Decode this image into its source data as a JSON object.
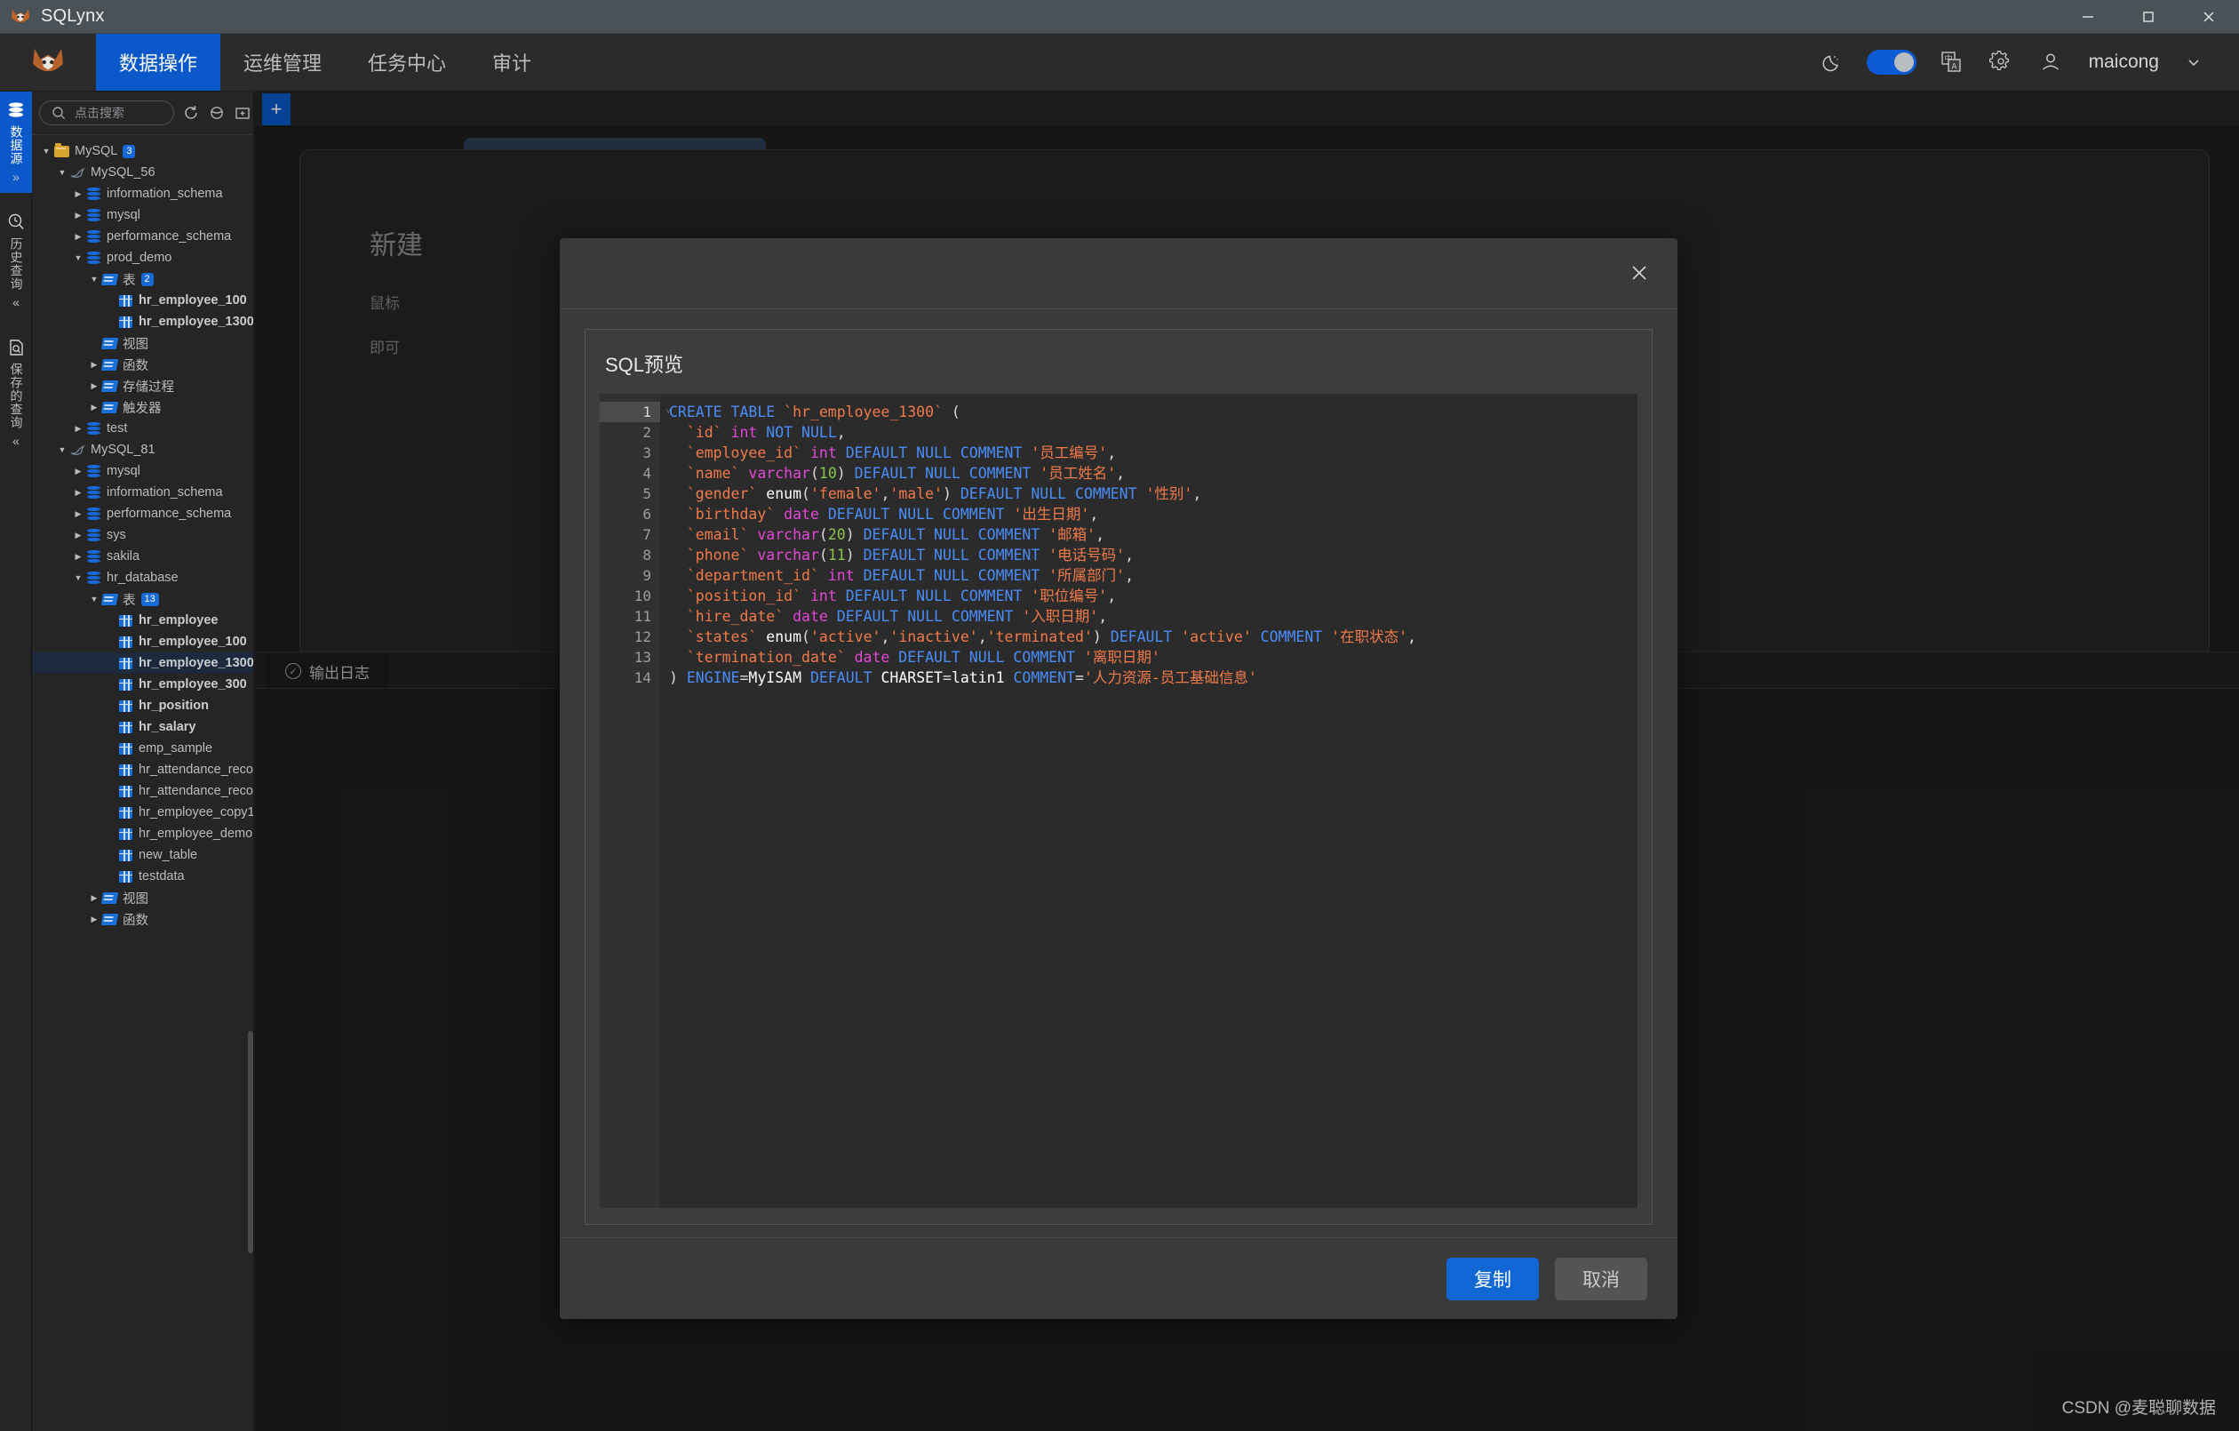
{
  "window": {
    "app_title": "SQLynx",
    "logo_icon": "lynx-logo-icon",
    "minimize_icon": "minimize-icon",
    "maximize_icon": "maximize-icon",
    "close_icon": "close-icon"
  },
  "menubar": {
    "brand_icon": "lynx-brand-icon",
    "items": [
      {
        "label": "数据操作",
        "active": true
      },
      {
        "label": "运维管理",
        "active": false
      },
      {
        "label": "任务中心",
        "active": false
      },
      {
        "label": "审计",
        "active": false
      }
    ],
    "right": {
      "theme_icon": "moon-icon",
      "theme_toggle_on": true,
      "language_icon": "language-translate-icon",
      "settings_icon": "gear-icon",
      "user_icon": "user-avatar-icon",
      "user_name": "maicong",
      "chevron_icon": "chevron-down-icon"
    }
  },
  "rail": {
    "groups": [
      {
        "icon": "database-icon",
        "label": "数据源",
        "chevron": "»",
        "active": true
      },
      {
        "icon": "history-clock-icon",
        "label": "历史查询",
        "chevron": "«",
        "active": false
      },
      {
        "icon": "saved-query-icon",
        "label": "保存的查询",
        "chevron": "«",
        "active": false
      }
    ]
  },
  "sidebar": {
    "search": {
      "placeholder": "点击搜索",
      "icon": "search-icon"
    },
    "toolbar_icons": [
      "refresh-icon",
      "filter-icon",
      "new-folder-icon"
    ],
    "tree": [
      {
        "depth": 0,
        "arrow": "down",
        "icon": "folder",
        "label": "MySQL",
        "badge": "3",
        "bold": false,
        "selected": false
      },
      {
        "depth": 1,
        "arrow": "down",
        "icon": "dolphin",
        "label": "MySQL_56",
        "badge": "",
        "bold": false,
        "selected": false
      },
      {
        "depth": 2,
        "arrow": "right",
        "icon": "db",
        "label": "information_schema",
        "badge": "",
        "bold": false,
        "selected": false
      },
      {
        "depth": 2,
        "arrow": "right",
        "icon": "db",
        "label": "mysql",
        "badge": "",
        "bold": false,
        "selected": false
      },
      {
        "depth": 2,
        "arrow": "right",
        "icon": "db",
        "label": "performance_schema",
        "badge": "",
        "bold": false,
        "selected": false
      },
      {
        "depth": 2,
        "arrow": "down",
        "icon": "db",
        "label": "prod_demo",
        "badge": "",
        "bold": false,
        "selected": false
      },
      {
        "depth": 3,
        "arrow": "down",
        "icon": "bfolder",
        "label": "表",
        "badge": "2",
        "bold": false,
        "selected": false
      },
      {
        "depth": 4,
        "arrow": "none",
        "icon": "table",
        "label": "hr_employee_100",
        "badge": "",
        "bold": true,
        "selected": false
      },
      {
        "depth": 4,
        "arrow": "none",
        "icon": "table",
        "label": "hr_employee_1300",
        "badge": "",
        "bold": true,
        "selected": false
      },
      {
        "depth": 3,
        "arrow": "none",
        "icon": "bfolder",
        "label": "视图",
        "badge": "",
        "bold": false,
        "selected": false
      },
      {
        "depth": 3,
        "arrow": "right",
        "icon": "bfolder",
        "label": "函数",
        "badge": "",
        "bold": false,
        "selected": false
      },
      {
        "depth": 3,
        "arrow": "right",
        "icon": "bfolder",
        "label": "存储过程",
        "badge": "",
        "bold": false,
        "selected": false
      },
      {
        "depth": 3,
        "arrow": "right",
        "icon": "bfolder",
        "label": "触发器",
        "badge": "",
        "bold": false,
        "selected": false
      },
      {
        "depth": 2,
        "arrow": "right",
        "icon": "db",
        "label": "test",
        "badge": "",
        "bold": false,
        "selected": false
      },
      {
        "depth": 1,
        "arrow": "down",
        "icon": "dolphin",
        "label": "MySQL_81",
        "badge": "",
        "bold": false,
        "selected": false
      },
      {
        "depth": 2,
        "arrow": "right",
        "icon": "db",
        "label": "mysql",
        "badge": "",
        "bold": false,
        "selected": false
      },
      {
        "depth": 2,
        "arrow": "right",
        "icon": "db",
        "label": "information_schema",
        "badge": "",
        "bold": false,
        "selected": false
      },
      {
        "depth": 2,
        "arrow": "right",
        "icon": "db",
        "label": "performance_schema",
        "badge": "",
        "bold": false,
        "selected": false
      },
      {
        "depth": 2,
        "arrow": "right",
        "icon": "db",
        "label": "sys",
        "badge": "",
        "bold": false,
        "selected": false
      },
      {
        "depth": 2,
        "arrow": "right",
        "icon": "db",
        "label": "sakila",
        "badge": "",
        "bold": false,
        "selected": false
      },
      {
        "depth": 2,
        "arrow": "down",
        "icon": "db",
        "label": "hr_database",
        "badge": "",
        "bold": false,
        "selected": false
      },
      {
        "depth": 3,
        "arrow": "down",
        "icon": "bfolder",
        "label": "表",
        "badge": "13",
        "bold": false,
        "selected": false
      },
      {
        "depth": 4,
        "arrow": "none",
        "icon": "table",
        "label": "hr_employee",
        "badge": "",
        "bold": true,
        "selected": false
      },
      {
        "depth": 4,
        "arrow": "none",
        "icon": "table",
        "label": "hr_employee_100",
        "badge": "",
        "bold": true,
        "selected": false
      },
      {
        "depth": 4,
        "arrow": "none",
        "icon": "table",
        "label": "hr_employee_1300",
        "badge": "",
        "bold": true,
        "selected": true
      },
      {
        "depth": 4,
        "arrow": "none",
        "icon": "table",
        "label": "hr_employee_300",
        "badge": "",
        "bold": true,
        "selected": false
      },
      {
        "depth": 4,
        "arrow": "none",
        "icon": "table",
        "label": "hr_position",
        "badge": "",
        "bold": true,
        "selected": false
      },
      {
        "depth": 4,
        "arrow": "none",
        "icon": "table",
        "label": "hr_salary",
        "badge": "",
        "bold": true,
        "selected": false
      },
      {
        "depth": 4,
        "arrow": "none",
        "icon": "table",
        "label": "emp_sample",
        "badge": "",
        "bold": false,
        "selected": false
      },
      {
        "depth": 4,
        "arrow": "none",
        "icon": "table",
        "label": "hr_attendance_records",
        "badge": "",
        "bold": false,
        "selected": false
      },
      {
        "depth": 4,
        "arrow": "none",
        "icon": "table",
        "label": "hr_attendance_records_s",
        "badge": "",
        "bold": false,
        "selected": false
      },
      {
        "depth": 4,
        "arrow": "none",
        "icon": "table",
        "label": "hr_employee_copy1",
        "badge": "",
        "bold": false,
        "selected": false
      },
      {
        "depth": 4,
        "arrow": "none",
        "icon": "table",
        "label": "hr_employee_demo",
        "badge": "",
        "bold": false,
        "selected": false
      },
      {
        "depth": 4,
        "arrow": "none",
        "icon": "table",
        "label": "new_table",
        "badge": "",
        "bold": false,
        "selected": false
      },
      {
        "depth": 4,
        "arrow": "none",
        "icon": "table",
        "label": "testdata",
        "badge": "",
        "bold": false,
        "selected": false
      },
      {
        "depth": 3,
        "arrow": "right",
        "icon": "bfolder",
        "label": "视图",
        "badge": "",
        "bold": false,
        "selected": false
      },
      {
        "depth": 3,
        "arrow": "right",
        "icon": "bfolder",
        "label": "函数",
        "badge": "",
        "bold": false,
        "selected": false
      }
    ]
  },
  "workspace": {
    "new_tab_label": "+",
    "placeholder_title": "新建",
    "placeholder_line1": "鼠标",
    "placeholder_line2": "即可",
    "log_tab_label": "输出日志",
    "log_tab_icon": "check-circle-icon"
  },
  "modal": {
    "close_icon": "close-icon",
    "card_title": "SQL预览",
    "buttons": {
      "copy": "复制",
      "cancel": "取消"
    },
    "code_lines": [
      {
        "n": 1,
        "current": true,
        "fold": "˅",
        "tokens": [
          {
            "c": "k",
            "t": "CREATE TABLE "
          },
          {
            "c": "id",
            "t": "`hr_employee_1300`"
          },
          {
            "c": "p",
            "t": " ("
          }
        ]
      },
      {
        "n": 2,
        "current": false,
        "fold": "",
        "tokens": [
          {
            "c": "p",
            "t": "  "
          },
          {
            "c": "id",
            "t": "`id`"
          },
          {
            "c": "t",
            "t": " int"
          },
          {
            "c": "k",
            "t": " NOT NULL"
          },
          {
            "c": "p",
            "t": ","
          }
        ]
      },
      {
        "n": 3,
        "current": false,
        "fold": "",
        "tokens": [
          {
            "c": "p",
            "t": "  "
          },
          {
            "c": "id",
            "t": "`employee_id`"
          },
          {
            "c": "t",
            "t": " int"
          },
          {
            "c": "k",
            "t": " DEFAULT NULL COMMENT "
          },
          {
            "c": "s",
            "t": "'员工编号'"
          },
          {
            "c": "p",
            "t": ","
          }
        ]
      },
      {
        "n": 4,
        "current": false,
        "fold": "",
        "tokens": [
          {
            "c": "p",
            "t": "  "
          },
          {
            "c": "id",
            "t": "`name`"
          },
          {
            "c": "t",
            "t": " varchar"
          },
          {
            "c": "p",
            "t": "("
          },
          {
            "c": "n",
            "t": "10"
          },
          {
            "c": "p",
            "t": ")"
          },
          {
            "c": "k",
            "t": " DEFAULT NULL COMMENT "
          },
          {
            "c": "s",
            "t": "'员工姓名'"
          },
          {
            "c": "p",
            "t": ","
          }
        ]
      },
      {
        "n": 5,
        "current": false,
        "fold": "",
        "tokens": [
          {
            "c": "p",
            "t": "  "
          },
          {
            "c": "id",
            "t": "`gender`"
          },
          {
            "c": "w",
            "t": " enum"
          },
          {
            "c": "p",
            "t": "("
          },
          {
            "c": "s",
            "t": "'female'"
          },
          {
            "c": "p",
            "t": ","
          },
          {
            "c": "s",
            "t": "'male'"
          },
          {
            "c": "p",
            "t": ")"
          },
          {
            "c": "k",
            "t": " DEFAULT NULL COMMENT "
          },
          {
            "c": "s",
            "t": "'性别'"
          },
          {
            "c": "p",
            "t": ","
          }
        ]
      },
      {
        "n": 6,
        "current": false,
        "fold": "",
        "tokens": [
          {
            "c": "p",
            "t": "  "
          },
          {
            "c": "id",
            "t": "`birthday`"
          },
          {
            "c": "t",
            "t": " date"
          },
          {
            "c": "k",
            "t": " DEFAULT NULL COMMENT "
          },
          {
            "c": "s",
            "t": "'出生日期'"
          },
          {
            "c": "p",
            "t": ","
          }
        ]
      },
      {
        "n": 7,
        "current": false,
        "fold": "",
        "tokens": [
          {
            "c": "p",
            "t": "  "
          },
          {
            "c": "id",
            "t": "`email`"
          },
          {
            "c": "t",
            "t": " varchar"
          },
          {
            "c": "p",
            "t": "("
          },
          {
            "c": "n",
            "t": "20"
          },
          {
            "c": "p",
            "t": ")"
          },
          {
            "c": "k",
            "t": " DEFAULT NULL COMMENT "
          },
          {
            "c": "s",
            "t": "'邮箱'"
          },
          {
            "c": "p",
            "t": ","
          }
        ]
      },
      {
        "n": 8,
        "current": false,
        "fold": "",
        "tokens": [
          {
            "c": "p",
            "t": "  "
          },
          {
            "c": "id",
            "t": "`phone`"
          },
          {
            "c": "t",
            "t": " varchar"
          },
          {
            "c": "p",
            "t": "("
          },
          {
            "c": "n",
            "t": "11"
          },
          {
            "c": "p",
            "t": ")"
          },
          {
            "c": "k",
            "t": " DEFAULT NULL COMMENT "
          },
          {
            "c": "s",
            "t": "'电话号码'"
          },
          {
            "c": "p",
            "t": ","
          }
        ]
      },
      {
        "n": 9,
        "current": false,
        "fold": "",
        "tokens": [
          {
            "c": "p",
            "t": "  "
          },
          {
            "c": "id",
            "t": "`department_id`"
          },
          {
            "c": "t",
            "t": " int"
          },
          {
            "c": "k",
            "t": " DEFAULT NULL COMMENT "
          },
          {
            "c": "s",
            "t": "'所属部门'"
          },
          {
            "c": "p",
            "t": ","
          }
        ]
      },
      {
        "n": 10,
        "current": false,
        "fold": "",
        "tokens": [
          {
            "c": "p",
            "t": "  "
          },
          {
            "c": "id",
            "t": "`position_id`"
          },
          {
            "c": "t",
            "t": " int"
          },
          {
            "c": "k",
            "t": " DEFAULT NULL COMMENT "
          },
          {
            "c": "s",
            "t": "'职位编号'"
          },
          {
            "c": "p",
            "t": ","
          }
        ]
      },
      {
        "n": 11,
        "current": false,
        "fold": "",
        "tokens": [
          {
            "c": "p",
            "t": "  "
          },
          {
            "c": "id",
            "t": "`hire_date`"
          },
          {
            "c": "t",
            "t": " date"
          },
          {
            "c": "k",
            "t": " DEFAULT NULL COMMENT "
          },
          {
            "c": "s",
            "t": "'入职日期'"
          },
          {
            "c": "p",
            "t": ","
          }
        ]
      },
      {
        "n": 12,
        "current": false,
        "fold": "",
        "tokens": [
          {
            "c": "p",
            "t": "  "
          },
          {
            "c": "id",
            "t": "`states`"
          },
          {
            "c": "w",
            "t": " enum"
          },
          {
            "c": "p",
            "t": "("
          },
          {
            "c": "s",
            "t": "'active'"
          },
          {
            "c": "p",
            "t": ","
          },
          {
            "c": "s",
            "t": "'inactive'"
          },
          {
            "c": "p",
            "t": ","
          },
          {
            "c": "s",
            "t": "'terminated'"
          },
          {
            "c": "p",
            "t": ") "
          },
          {
            "c": "k",
            "t": "DEFAULT "
          },
          {
            "c": "s",
            "t": "'active'"
          },
          {
            "c": "k",
            "t": " COMMENT "
          },
          {
            "c": "s",
            "t": "'在职状态'"
          },
          {
            "c": "p",
            "t": ","
          }
        ]
      },
      {
        "n": 13,
        "current": false,
        "fold": "",
        "tokens": [
          {
            "c": "p",
            "t": "  "
          },
          {
            "c": "id",
            "t": "`termination_date`"
          },
          {
            "c": "t",
            "t": " date"
          },
          {
            "c": "k",
            "t": " DEFAULT NULL COMMENT "
          },
          {
            "c": "s",
            "t": "'离职日期'"
          }
        ]
      },
      {
        "n": 14,
        "current": false,
        "fold": "",
        "tokens": [
          {
            "c": "p",
            "t": ") "
          },
          {
            "c": "k",
            "t": "ENGINE"
          },
          {
            "c": "p",
            "t": "="
          },
          {
            "c": "w",
            "t": "MyISAM "
          },
          {
            "c": "k",
            "t": "DEFAULT "
          },
          {
            "c": "w",
            "t": "CHARSET"
          },
          {
            "c": "p",
            "t": "="
          },
          {
            "c": "w",
            "t": "latin1"
          },
          {
            "c": "k",
            "t": " COMMENT"
          },
          {
            "c": "p",
            "t": "="
          },
          {
            "c": "s",
            "t": "'人力资源-员工基础信息'"
          }
        ]
      }
    ]
  },
  "footer": {
    "watermark": "CSDN @麦聪聊数据"
  },
  "colors": {
    "accent": "#0a58ca",
    "primary_btn": "#1267d6",
    "selected_row": "#1d2a3d",
    "badge": "#1669d6"
  }
}
